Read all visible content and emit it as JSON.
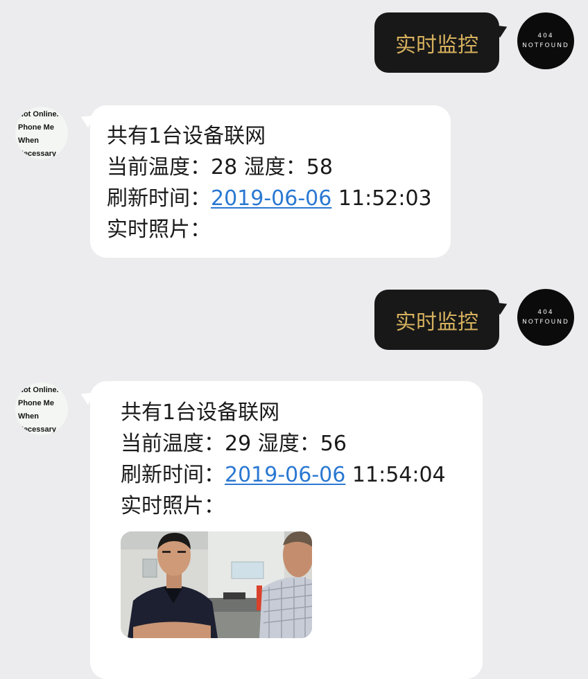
{
  "sent_avatar": {
    "line1": "404",
    "line2": "NOTFOUND"
  },
  "bot_avatar": {
    "lines": [
      "Not Online.",
      "Phone Me",
      "When",
      "Necessary."
    ]
  },
  "messages": [
    {
      "direction": "outgoing",
      "text": "实时监控"
    },
    {
      "direction": "incoming",
      "device_line": "共有1台设备联网",
      "temp_label": "当前温度：",
      "temp_value": "28",
      "humidity_label": "湿度：",
      "humidity_value": "58",
      "time_label": "刷新时间：",
      "date": "2019-06-06",
      "time": "11:52:03",
      "photo_label": "实时照片："
    },
    {
      "direction": "outgoing",
      "text": "实时监控"
    },
    {
      "direction": "incoming",
      "device_line": "共有1台设备联网",
      "temp_label": "当前温度：",
      "temp_value": "29",
      "humidity_label": "湿度：",
      "humidity_value": "56",
      "time_label": "刷新时间：",
      "date": "2019-06-06",
      "time": "11:54:04",
      "photo_label": "实时照片：",
      "photo": "live-monitoring-photo"
    }
  ],
  "colors": {
    "background": "#ececef",
    "outgoing_bubble": "#181818",
    "outgoing_text": "#d6b15e",
    "incoming_bubble": "#ffffff",
    "link": "#2a78d2"
  }
}
